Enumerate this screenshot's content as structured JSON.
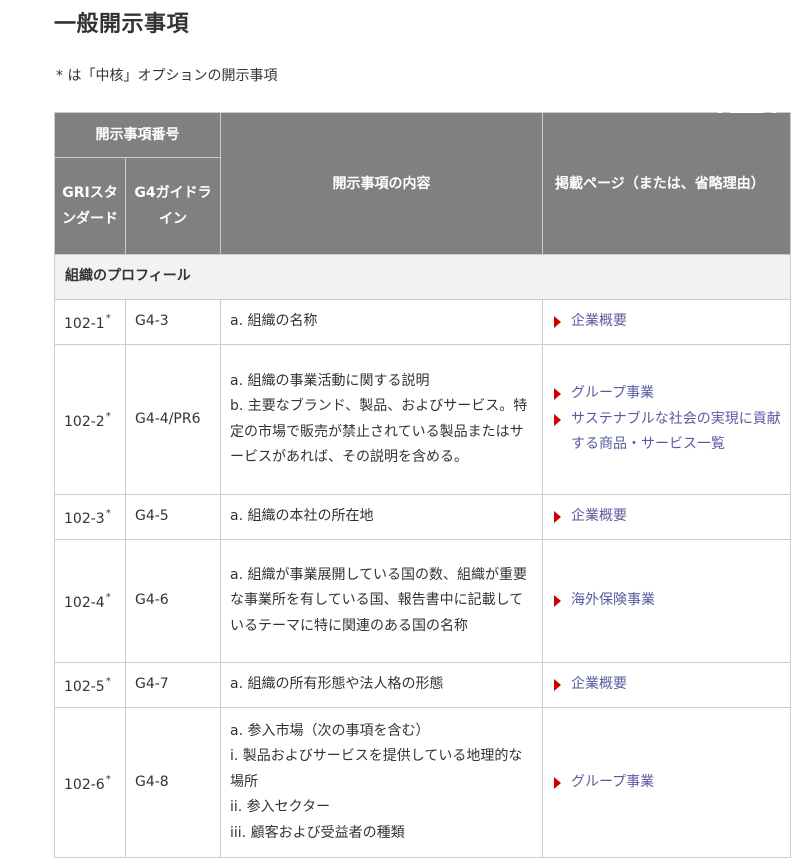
{
  "page_title": "一般開示事項",
  "core_note": "* は「中核」オプションの開示事項",
  "table": {
    "header": {
      "disclosure_number": "開示事項番号",
      "gri_standard": "GRIスタンダード",
      "g4_guideline": "G4ガイドライン",
      "disclosure_content": "開示事項の内容",
      "page_reference": "掲載ページ（または、省略理由）"
    },
    "section": "組織のプロフィール",
    "star": "*",
    "rows": [
      {
        "gri": "102-1",
        "g4": "G4-3",
        "desc": [
          "a. 組織の名称"
        ],
        "links": [
          "企業概要"
        ]
      },
      {
        "gri": "102-2",
        "g4": "G4-4/PR6",
        "desc": [
          "a. 組織の事業活動に関する説明",
          "b. 主要なブランド、製品、およびサービス。特定の市場で販売が禁止されている製品またはサービスがあれば、その説明を含める。"
        ],
        "links": [
          "グループ事業",
          "サステナブルな社会の実現に貢献する商品・サービス一覧"
        ]
      },
      {
        "gri": "102-3",
        "g4": "G4-5",
        "desc": [
          "a. 組織の本社の所在地"
        ],
        "links": [
          "企業概要"
        ]
      },
      {
        "gri": "102-4",
        "g4": "G4-6",
        "desc": [
          "a. 組織が事業展開している国の数、組織が重要な事業所を有している国、報告書中に記載しているテーマに特に関連のある国の名称"
        ],
        "links": [
          "海外保険事業"
        ]
      },
      {
        "gri": "102-5",
        "g4": "G4-7",
        "desc": [
          "a. 組織の所有形態や法人格の形態"
        ],
        "links": [
          "企業概要"
        ]
      },
      {
        "gri": "102-6",
        "g4": "G4-8",
        "desc": [
          "a. 参入市場（次の事項を含む）",
          "i. 製品およびサービスを提供している地理的な場所",
          "ii. 参入セクター",
          "iii. 顧客および受益者の種類"
        ],
        "links": [
          "グループ事業"
        ]
      }
    ]
  }
}
